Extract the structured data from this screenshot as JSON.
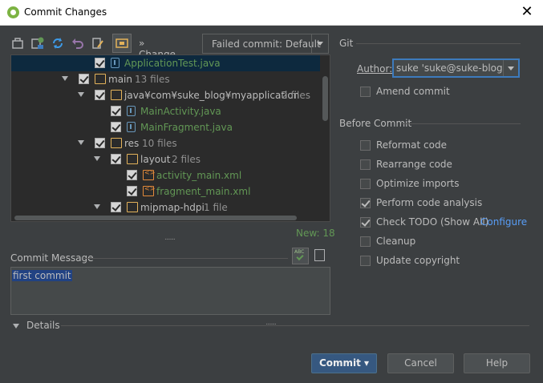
{
  "window": {
    "title": "Commit Changes"
  },
  "toolbar": {
    "changelist_label": "» Change list:",
    "changelist_value": "Failed commit: Default"
  },
  "tree": {
    "rows": [
      {
        "label": "ApplicationTest.java",
        "count": "",
        "kind": "java"
      },
      {
        "label": "main",
        "count": "13 files",
        "kind": "folder"
      },
      {
        "label": "java¥com¥suke_blog¥myapplication",
        "count": "2 files",
        "kind": "folder"
      },
      {
        "label": "MainActivity.java",
        "count": "",
        "kind": "java"
      },
      {
        "label": "MainFragment.java",
        "count": "",
        "kind": "java"
      },
      {
        "label": "res",
        "count": "10 files",
        "kind": "folder"
      },
      {
        "label": "layout",
        "count": "2 files",
        "kind": "folder"
      },
      {
        "label": "activity_main.xml",
        "count": "",
        "kind": "xml"
      },
      {
        "label": "fragment_main.xml",
        "count": "",
        "kind": "xml"
      },
      {
        "label": "mipmap-hdpi",
        "count": "1 file",
        "kind": "folder"
      }
    ],
    "new_count": "New: 18"
  },
  "commit_message": {
    "label": "Commit Message",
    "text": "first commit"
  },
  "details": {
    "label": "Details"
  },
  "git": {
    "section_label": "Git",
    "author_label": "Author:",
    "author_value": "suke 'suke@suke-blog.cc",
    "amend_label": "Amend commit"
  },
  "before_commit": {
    "section_label": "Before Commit",
    "options": [
      {
        "label": "Reformat code",
        "checked": false
      },
      {
        "label": "Rearrange code",
        "checked": false
      },
      {
        "label": "Optimize imports",
        "checked": false
      },
      {
        "label": "Perform code analysis",
        "checked": true
      },
      {
        "label": "Check TODO (Show All)",
        "checked": true
      },
      {
        "label": "Cleanup",
        "checked": false
      },
      {
        "label": "Update copyright",
        "checked": false
      }
    ],
    "configure_link": "Configure"
  },
  "buttons": {
    "commit": "Commit ▾",
    "cancel": "Cancel",
    "help": "Help"
  },
  "colors": {
    "background": "#3c3f41",
    "tree_background": "#2b2b2b",
    "selection": "#0d293e",
    "new_file_green": "#629755",
    "link_blue": "#589df6",
    "primary_button": "#365880"
  }
}
